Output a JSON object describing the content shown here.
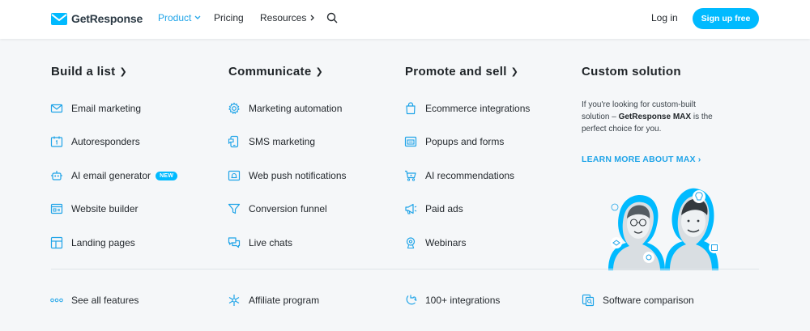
{
  "header": {
    "logo_text": "GetResponse",
    "nav": [
      {
        "label": "Product",
        "active": true
      },
      {
        "label": "Pricing"
      },
      {
        "label": "Resources"
      }
    ],
    "login_label": "Log in",
    "signup_label": "Sign up free"
  },
  "columns": [
    {
      "title": "Build a list",
      "items": [
        {
          "label": "Email marketing",
          "icon": "mail-icon"
        },
        {
          "label": "Autoresponders",
          "icon": "calendar-icon"
        },
        {
          "label": "AI email generator",
          "icon": "ai-robot-icon",
          "badge": "NEW"
        },
        {
          "label": "Website builder",
          "icon": "website-icon"
        },
        {
          "label": "Landing pages",
          "icon": "layout-icon"
        }
      ]
    },
    {
      "title": "Communicate",
      "items": [
        {
          "label": "Marketing automation",
          "icon": "gear-icon"
        },
        {
          "label": "SMS marketing",
          "icon": "phone-icon"
        },
        {
          "label": "Web push notifications",
          "icon": "bell-icon"
        },
        {
          "label": "Conversion funnel",
          "icon": "funnel-icon"
        },
        {
          "label": "Live chats",
          "icon": "chat-icon"
        }
      ]
    },
    {
      "title": "Promote and sell",
      "items": [
        {
          "label": "Ecommerce integrations",
          "icon": "shopping-bag-icon"
        },
        {
          "label": "Popups and forms",
          "icon": "popup-icon"
        },
        {
          "label": "AI recommendations",
          "icon": "ai-cart-icon"
        },
        {
          "label": "Paid ads",
          "icon": "megaphone-icon"
        },
        {
          "label": "Webinars",
          "icon": "webinar-icon"
        }
      ]
    },
    {
      "title": "Custom solution",
      "description_pre": "If you're looking for custom-built solution – ",
      "description_bold": "GetResponse MAX",
      "description_post": " is the perfect choice for you.",
      "link": "LEARN MORE ABOUT MAX ›"
    }
  ],
  "footer_links": [
    {
      "label": "See all features",
      "icon": "dots-icon"
    },
    {
      "label": "Affiliate program",
      "icon": "snowflake-icon"
    },
    {
      "label": "100+ integrations",
      "icon": "puzzle-icon"
    },
    {
      "label": "Software comparison",
      "icon": "compare-icon"
    }
  ],
  "colors": {
    "accent": "#00baff",
    "link": "#1fa4e8",
    "background": "#f5f7f9"
  }
}
